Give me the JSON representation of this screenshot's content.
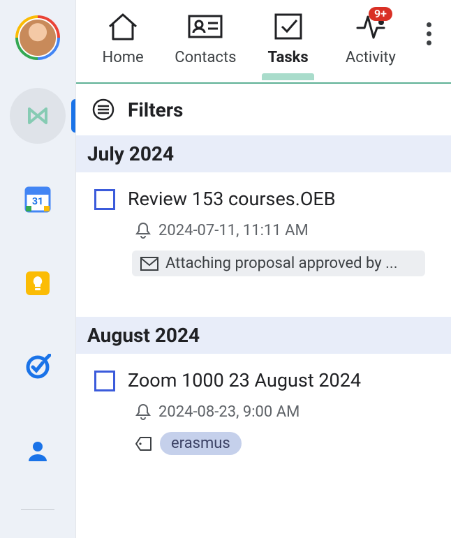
{
  "tabs": {
    "home": "Home",
    "contacts": "Contacts",
    "tasks": "Tasks",
    "activity": "Activity",
    "activity_badge": "9+"
  },
  "filters": {
    "label": "Filters"
  },
  "sections": [
    {
      "header": "July 2024"
    },
    {
      "header": "August 2024"
    }
  ],
  "tasks": [
    {
      "title": "Review 153 courses.OEB",
      "reminder": "2024-07-11, 11:11 AM",
      "attachment": "Attaching proposal approved by ..."
    },
    {
      "title": "Zoom 1000 23 August 2024",
      "reminder": "2024-08-23, 9:00 AM",
      "tag": "erasmus"
    }
  ]
}
